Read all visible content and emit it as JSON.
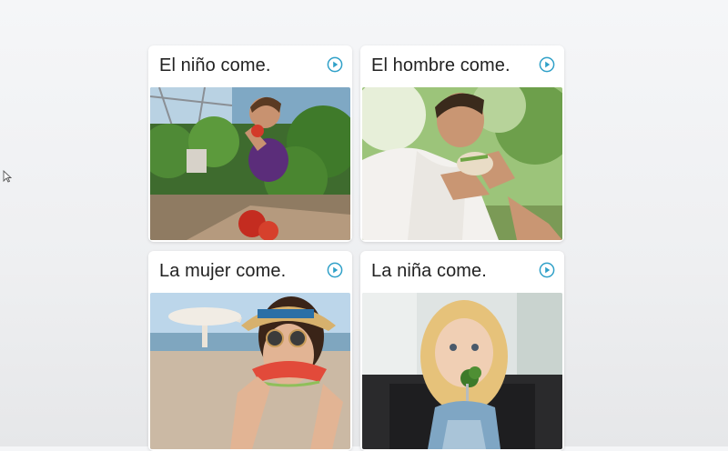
{
  "cards": [
    {
      "caption": "El niño come.",
      "audio_icon": "play-circle-icon",
      "image_subject": "boy eating tomato in garden"
    },
    {
      "caption": "El hombre come.",
      "audio_icon": "play-circle-icon",
      "image_subject": "man eating sandwich outdoors"
    },
    {
      "caption": "La mujer come.",
      "audio_icon": "play-circle-icon",
      "image_subject": "woman eating watermelon on beach"
    },
    {
      "caption": "La niña come.",
      "audio_icon": "play-circle-icon",
      "image_subject": "girl eating broccoli"
    }
  ],
  "colors": {
    "accent": "#2fa0c8",
    "caption_text": "#222222",
    "card_bg": "#ffffff"
  }
}
